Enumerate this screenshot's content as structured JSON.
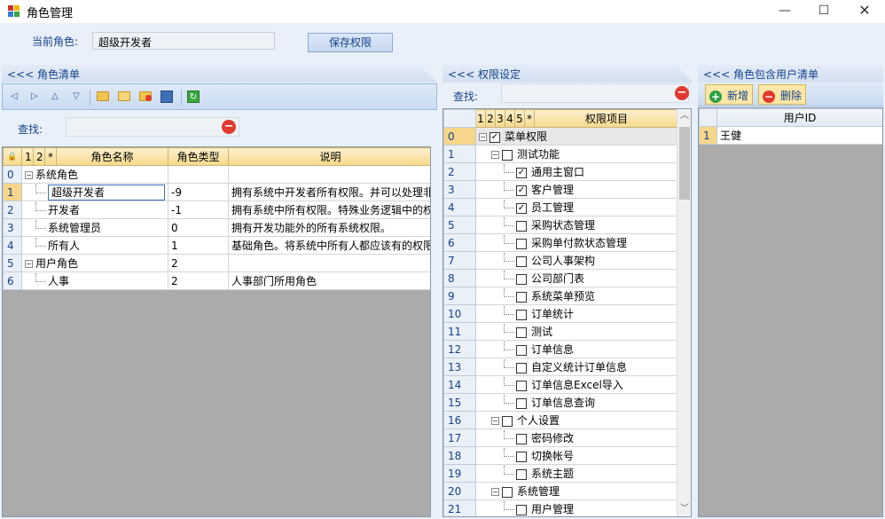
{
  "window": {
    "title": "角色管理",
    "minimize": "—",
    "maximize": "☐",
    "close": "✕"
  },
  "top": {
    "current_role_label": "当前角色:",
    "current_role_value": "超级开发者",
    "save_button": "保存权限"
  },
  "role_panel": {
    "header": "<<< 角色清单",
    "search_label": "查找:",
    "col_headers": {
      "c1": "1",
      "c2": "2",
      "star": "*",
      "name": "角色名称",
      "type": "角色类型",
      "desc": "说明"
    },
    "rows": [
      {
        "n": "0",
        "name": "系统角色",
        "type": "",
        "desc": "",
        "level": 0,
        "expander": "⊟"
      },
      {
        "n": "1",
        "name": "超级开发者",
        "type": "-9",
        "desc": "拥有系统中开发者所有权限。并可以处理非",
        "level": 1,
        "editing": true
      },
      {
        "n": "2",
        "name": "开发者",
        "type": "-1",
        "desc": "拥有系统中所有权限。特殊业务逻辑中的权",
        "level": 1
      },
      {
        "n": "3",
        "name": "系统管理员",
        "type": "0",
        "desc": "拥有开发功能外的所有系统权限。",
        "level": 1
      },
      {
        "n": "4",
        "name": "所有人",
        "type": "1",
        "desc": "基础角色。将系统中所有人都应该有的权限",
        "level": 1
      },
      {
        "n": "5",
        "name": "用户角色",
        "type": "2",
        "desc": "",
        "level": 0,
        "expander": "⊟"
      },
      {
        "n": "6",
        "name": "人事",
        "type": "2",
        "desc": "人事部门所用角色",
        "level": 1
      }
    ]
  },
  "perm_panel": {
    "header": "<<< 权限设定",
    "search_label": "查找:",
    "col_headers": {
      "c1": "1",
      "c2": "2",
      "c3": "3",
      "c4": "4",
      "c5": "5",
      "star": "*",
      "name": "权限项目"
    },
    "rows": [
      {
        "n": "0",
        "name": "菜单权限",
        "level": 0,
        "checked": true,
        "expander": "⊟"
      },
      {
        "n": "1",
        "name": "测试功能",
        "level": 1,
        "checked": false,
        "expander": "⊟"
      },
      {
        "n": "2",
        "name": "通用主窗口",
        "level": 2,
        "checked": true
      },
      {
        "n": "3",
        "name": "客户管理",
        "level": 2,
        "checked": true
      },
      {
        "n": "4",
        "name": "员工管理",
        "level": 2,
        "checked": true
      },
      {
        "n": "5",
        "name": "采购状态管理",
        "level": 2,
        "checked": false
      },
      {
        "n": "6",
        "name": "采购单付款状态管理",
        "level": 2,
        "checked": false
      },
      {
        "n": "7",
        "name": "公司人事架构",
        "level": 2,
        "checked": false
      },
      {
        "n": "8",
        "name": "公司部门表",
        "level": 2,
        "checked": false
      },
      {
        "n": "9",
        "name": "系统菜单预览",
        "level": 2,
        "checked": false
      },
      {
        "n": "10",
        "name": "订单统计",
        "level": 2,
        "checked": false
      },
      {
        "n": "11",
        "name": "测试",
        "level": 2,
        "checked": false
      },
      {
        "n": "12",
        "name": "订单信息",
        "level": 2,
        "checked": false
      },
      {
        "n": "13",
        "name": "自定义统计订单信息",
        "level": 2,
        "checked": false
      },
      {
        "n": "14",
        "name": "订单信息Excel导入",
        "level": 2,
        "checked": false
      },
      {
        "n": "15",
        "name": "订单信息查询",
        "level": 2,
        "checked": false
      },
      {
        "n": "16",
        "name": "个人设置",
        "level": 1,
        "checked": false,
        "expander": "⊟"
      },
      {
        "n": "17",
        "name": "密码修改",
        "level": 2,
        "checked": false
      },
      {
        "n": "18",
        "name": "切换帐号",
        "level": 2,
        "checked": false
      },
      {
        "n": "19",
        "name": "系统主题",
        "level": 2,
        "checked": false
      },
      {
        "n": "20",
        "name": "系统管理",
        "level": 1,
        "checked": false,
        "expander": "⊟"
      },
      {
        "n": "21",
        "name": "用户管理",
        "level": 2,
        "checked": false
      }
    ]
  },
  "user_panel": {
    "header": "<<< 角色包含用户清单",
    "add_button": "新增",
    "delete_button": "删除",
    "col_header": "用户ID",
    "rows": [
      {
        "n": "1",
        "user": "王健"
      }
    ]
  },
  "colors": {
    "accent_text": "#15428b",
    "header_gold": "#f6d98a",
    "selected_row": "#f7d58a",
    "check_red": "#e03a2f",
    "add_green": "#2ea043"
  }
}
